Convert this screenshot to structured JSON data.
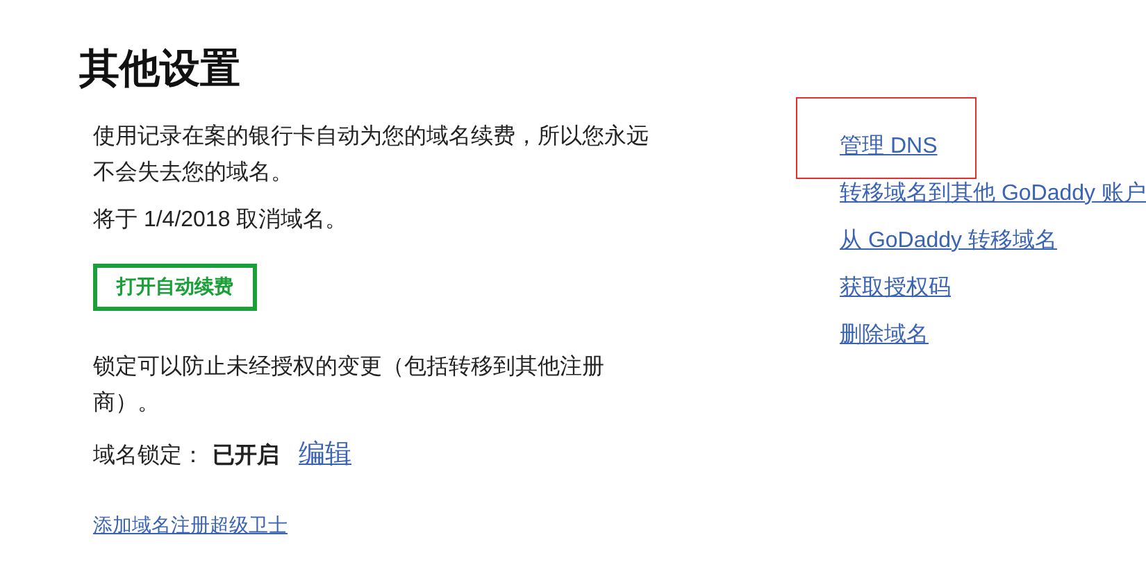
{
  "title": "其他设置",
  "auto_renew": {
    "description": "使用记录在案的银行卡自动为您的域名续费，所以您永远不会失去您的域名。",
    "cancel_notice": "将于 1/4/2018 取消域名。",
    "button": "打开自动续费"
  },
  "lock": {
    "description": "锁定可以防止未经授权的变更（包括转移到其他注册商）。",
    "label": "域名锁定：",
    "status": "已开启",
    "edit_link": "编辑"
  },
  "bottom_link": "添加域名注册超级卫士",
  "links": [
    {
      "label": "管理 DNS",
      "highlighted": true
    },
    {
      "label": "转移域名到其他 GoDaddy 账户",
      "highlighted": false
    },
    {
      "label": "从 GoDaddy 转移域名",
      "highlighted": false
    },
    {
      "label": "获取授权码",
      "highlighted": false
    },
    {
      "label": "删除域名",
      "highlighted": false
    }
  ]
}
